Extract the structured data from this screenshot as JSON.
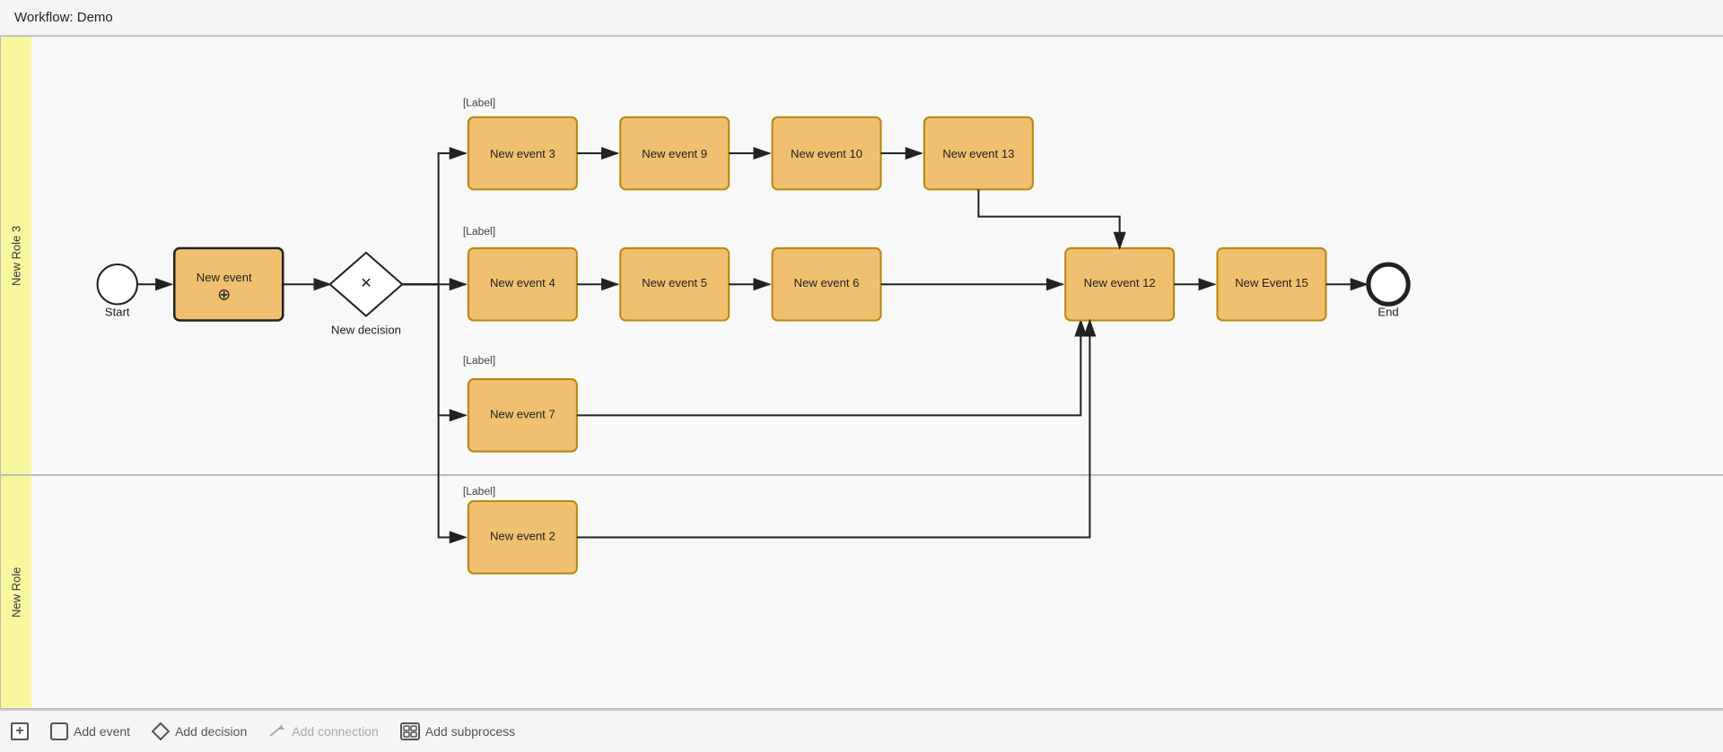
{
  "title": "Workflow: Demo",
  "lanes": [
    {
      "id": "lane-top",
      "label": "New Role 3"
    },
    {
      "id": "lane-bottom",
      "label": "New Role"
    }
  ],
  "nodes": {
    "start": {
      "label": "Start"
    },
    "end": {
      "label": "End"
    },
    "new_event": {
      "label": "New event"
    },
    "new_decision": {
      "label": "New decision"
    },
    "new_event_3": {
      "label": "New event 3"
    },
    "new_event_9": {
      "label": "New event 9"
    },
    "new_event_10": {
      "label": "New event 10"
    },
    "new_event_13": {
      "label": "New event 13"
    },
    "new_event_4": {
      "label": "New event 4"
    },
    "new_event_5": {
      "label": "New event 5"
    },
    "new_event_6": {
      "label": "New event 6"
    },
    "new_event_7": {
      "label": "New event 7"
    },
    "new_event_12": {
      "label": "New event 12"
    },
    "new_event_15": {
      "label": "New Event 15"
    },
    "new_event_2": {
      "label": "New event 2"
    }
  },
  "labels": {
    "label_placeholder": "[Label]"
  },
  "toolbar": {
    "add_button_label": "+",
    "add_event_label": "Add event",
    "add_decision_label": "Add decision",
    "add_connection_label": "Add connection",
    "add_subprocess_label": "Add subprocess"
  }
}
